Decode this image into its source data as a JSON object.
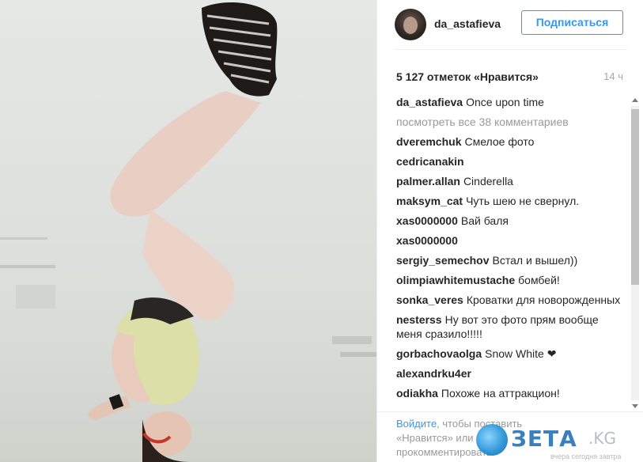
{
  "post": {
    "username": "da_astafieva",
    "follow_label": "Подписаться",
    "likes": "5 127 отметок «Нравится»",
    "time": "14 ч"
  },
  "comments": [
    {
      "author": "da_astafieva",
      "text": "Once upon time"
    },
    {
      "author": "",
      "text": "посмотреть все 38 комментариев"
    },
    {
      "author": "dveremchuk",
      "text": "Смелое фото"
    },
    {
      "author": "cedricanakin",
      "text": ""
    },
    {
      "author": "palmer.allan",
      "text": "Cinderella"
    },
    {
      "author": "maksym_cat",
      "text": "Чуть шею не свернул."
    },
    {
      "author": "xas0000000",
      "text": "Вай баля"
    },
    {
      "author": "xas0000000",
      "text": ""
    },
    {
      "author": "sergiy_semechov",
      "text": "Встал и вышел))"
    },
    {
      "author": "olimpiawhitemustache",
      "text": "бомбей!"
    },
    {
      "author": "sonka_veres",
      "text": "Кроватки для новорожденных"
    },
    {
      "author": "nesterss",
      "text": "Ну вот это фото прям вообще меня сразило!!!!!"
    },
    {
      "author": "gorbachovaolga",
      "text": "Snow White ❤"
    },
    {
      "author": "alexandrku4er",
      "text": ""
    },
    {
      "author": "odiakha",
      "text": "Похоже на аттракцион!"
    }
  ],
  "footer": {
    "login": "Войдите",
    "rest1": ", чтобы поставить",
    "line2": "«Нравится» или",
    "line3": "прокомментировать."
  },
  "watermark": {
    "brand": "ЗЕТА",
    "suffix": ".KG",
    "tagline": "вчера сегодня завтра"
  }
}
